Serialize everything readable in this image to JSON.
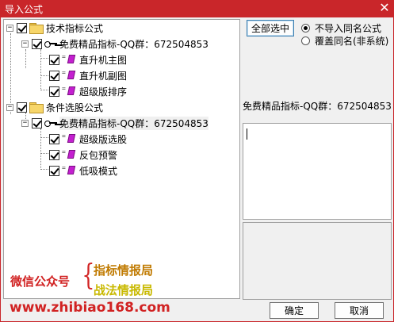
{
  "window": {
    "title": "导入公式",
    "close_glyph": "✕"
  },
  "tree": {
    "groups": [
      {
        "label": "技术指标公式",
        "checked": true,
        "expander": "−",
        "source": {
          "label": "免费精品指标-QQ群：672504853",
          "checked": true,
          "expander": "−"
        },
        "items": [
          {
            "label": "直升机主图",
            "checked": true
          },
          {
            "label": "直升机副图",
            "checked": true
          },
          {
            "label": "超级版排序",
            "checked": true
          }
        ]
      },
      {
        "label": "条件选股公式",
        "checked": true,
        "expander": "−",
        "source": {
          "label": "免费精品指标-QQ群：672504853",
          "checked": true,
          "expander": "−"
        },
        "items": [
          {
            "label": "超级版选股",
            "checked": true
          },
          {
            "label": "反包预警",
            "checked": true
          },
          {
            "label": "低吸模式",
            "checked": true
          }
        ]
      }
    ]
  },
  "right": {
    "select_all_label": "全部选中",
    "radio_options": [
      {
        "label": "不导入同名公式",
        "selected": true
      },
      {
        "label": "覆盖同名(非系统)",
        "selected": false
      }
    ],
    "source_label": "免费精品指标-QQ群：672504853",
    "description_text": ""
  },
  "footer": {
    "ok_label": "确定",
    "cancel_label": "取消"
  },
  "watermark": {
    "wechat_label": "微信公众号",
    "brace": "{",
    "line1": "指标情报局",
    "line2": "战法情报局",
    "url": "www.zhibiao168.com"
  },
  "colors": {
    "titlebar": "#c9262a",
    "watermark_red": "#d12222",
    "watermark_orange": "#c07a00",
    "watermark_yellow": "#c9b900"
  }
}
